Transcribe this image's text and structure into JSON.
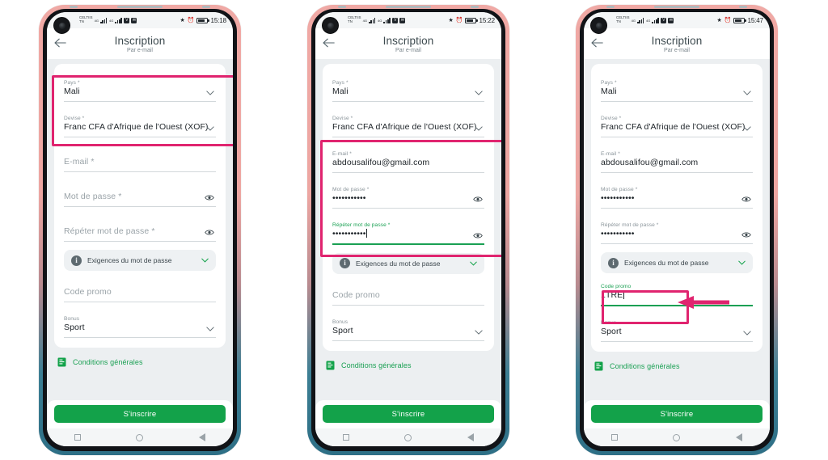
{
  "meta": {
    "accent_green": "#13a24a",
    "annotation_pink": "#e0246f",
    "frame_top": "#f0a9a5",
    "frame_bottom": "#2e6f86"
  },
  "app": {
    "title": "Inscription",
    "subtitle": "Par e-mail",
    "back_icon": "back-arrow-icon"
  },
  "status": {
    "carrier_line1": "CELTIIS",
    "carrier_line2": "TN",
    "net1": "4G",
    "net2": "4G",
    "icon_v": "V",
    "icon_mail": "✉"
  },
  "form": {
    "country": {
      "label": "Pays *",
      "value": "Mali"
    },
    "currency": {
      "label": "Devise *",
      "value": "Franc CFA d'Afrique de l'Ouest (XOF)"
    },
    "email": {
      "label": "E-mail *",
      "placeholder": "E-mail *",
      "value": "abdousalifou@gmail.com"
    },
    "password": {
      "label": "Mot de passe *",
      "placeholder": "Mot de passe *",
      "value": "•••••••••••"
    },
    "password_repeat": {
      "label": "Répéter mot de passe *",
      "placeholder": "Répéter mot de passe *",
      "value": "•••••••••••"
    },
    "requirements": {
      "label": "Exigences du mot de passe"
    },
    "promo": {
      "label": "Code promo",
      "placeholder": "Code promo",
      "value": "1TRE"
    },
    "bonus": {
      "label": "Bonus",
      "value": "Sport"
    },
    "terms": {
      "label": "Conditions générales"
    },
    "submit": {
      "label": "S'inscrire"
    }
  },
  "phones": [
    {
      "id": "phone-1",
      "clock": "15:18",
      "state": "country-currency-highlighted",
      "email_filled": false,
      "password_filled": false,
      "promo_filled": false,
      "focused_field": "none"
    },
    {
      "id": "phone-2",
      "clock": "15:22",
      "state": "credentials-highlighted",
      "email_filled": true,
      "password_filled": true,
      "promo_filled": false,
      "focused_field": "password_repeat"
    },
    {
      "id": "phone-3",
      "clock": "15:47",
      "state": "promo-code-highlighted",
      "email_filled": true,
      "password_filled": true,
      "promo_filled": true,
      "focused_field": "promo"
    }
  ],
  "nav": {
    "recents": "square-icon",
    "home": "circle-icon",
    "back": "triangle-back-icon"
  }
}
